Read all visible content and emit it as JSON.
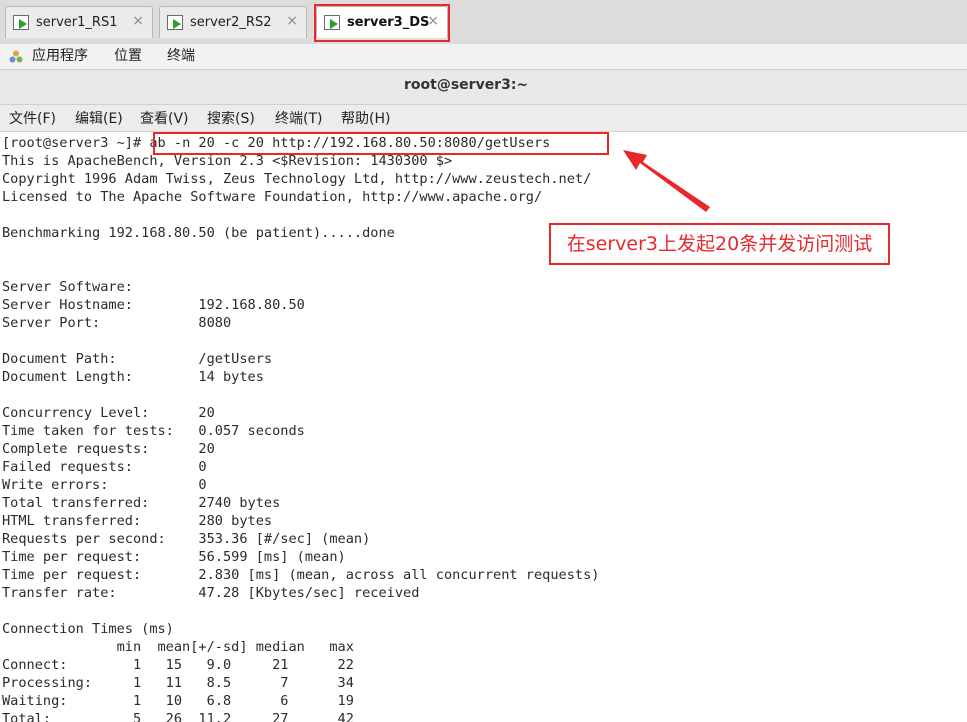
{
  "vm_tabs": [
    {
      "label": "server1_RS1",
      "close": "×"
    },
    {
      "label": "server2_RS2",
      "close": "×"
    },
    {
      "label": "server3_DS",
      "close": "×"
    }
  ],
  "top_panel": {
    "applications": "应用程序",
    "places": "位置",
    "terminal": "终端"
  },
  "window": {
    "title": "root@server3:~"
  },
  "menu": [
    "文件(F)",
    "编辑(E)",
    "查看(V)",
    "搜索(S)",
    "终端(T)",
    "帮助(H)"
  ],
  "terminal": {
    "prompt": "[root@server3 ~]# ",
    "command": "ab -n 20 -c 20 http://192.168.80.50:8080/getUsers",
    "lines": [
      "This is ApacheBench, Version 2.3 <$Revision: 1430300 $>",
      "Copyright 1996 Adam Twiss, Zeus Technology Ltd, http://www.zeustech.net/",
      "Licensed to The Apache Software Foundation, http://www.apache.org/",
      "",
      "Benchmarking 192.168.80.50 (be patient).....done",
      "",
      "",
      "Server Software:",
      "Server Hostname:        192.168.80.50",
      "Server Port:            8080",
      "",
      "Document Path:          /getUsers",
      "Document Length:        14 bytes",
      "",
      "Concurrency Level:      20",
      "Time taken for tests:   0.057 seconds",
      "Complete requests:      20",
      "Failed requests:        0",
      "Write errors:           0",
      "Total transferred:      2740 bytes",
      "HTML transferred:       280 bytes",
      "Requests per second:    353.36 [#/sec] (mean)",
      "Time per request:       56.599 [ms] (mean)",
      "Time per request:       2.830 [ms] (mean, across all concurrent requests)",
      "Transfer rate:          47.28 [Kbytes/sec] received",
      "",
      "Connection Times (ms)",
      "              min  mean[+/-sd] median   max",
      "Connect:        1   15   9.0     21      22",
      "Processing:     1   11   8.5      7      34",
      "Waiting:        1   10   6.8      6      19",
      "Total:          5   26  11.2     27      42"
    ]
  },
  "annotation": {
    "text": "在server3上发起20条并发访问测试",
    "color": "#e8282d"
  }
}
